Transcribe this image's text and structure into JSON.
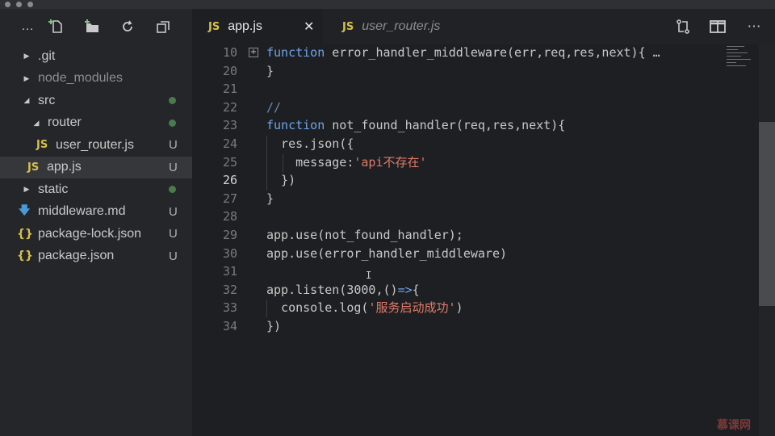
{
  "sidebar": {
    "toolbar": [
      {
        "icon": "more-icon",
        "glyph": "…"
      },
      {
        "icon": "new-file-icon",
        "glyph": "🗋"
      },
      {
        "icon": "new-folder-icon",
        "glyph": "🗀"
      },
      {
        "icon": "refresh-icon",
        "glyph": "↻"
      },
      {
        "icon": "collapse-all-icon",
        "glyph": "⧉"
      }
    ],
    "items": [
      {
        "label": ".git",
        "status": ""
      },
      {
        "label": "node_modules",
        "status": ""
      },
      {
        "label": "src",
        "status": "dot"
      },
      {
        "label": "router",
        "status": "dot"
      },
      {
        "label": "user_router.js",
        "status": "U",
        "icon_text": "JS"
      },
      {
        "label": "app.js",
        "status": "U",
        "icon_text": "JS"
      },
      {
        "label": "static",
        "status": "dot"
      },
      {
        "label": "middleware.md",
        "status": "U"
      },
      {
        "label": "package-lock.json",
        "status": "U",
        "icon_text": "{}"
      },
      {
        "label": "package.json",
        "status": "U",
        "icon_text": "{}"
      }
    ]
  },
  "tabs": [
    {
      "icon_text": "JS",
      "label": "app.js",
      "active": true,
      "close": "✕"
    },
    {
      "icon_text": "JS",
      "label": "user_router.js",
      "active": false
    }
  ],
  "toolbar_actions": [
    {
      "icon": "compare-icon",
      "glyph": "⇄"
    },
    {
      "icon": "split-editor-icon",
      "glyph": "◫"
    },
    {
      "icon": "more-actions-icon",
      "glyph": "⋯"
    }
  ],
  "editor": {
    "lines": [
      {
        "n": "10",
        "tokens": [
          [
            "kw",
            "function"
          ],
          [
            "fn",
            " error_handler_middleware"
          ],
          [
            "punc",
            "(err,req,res,next){"
          ],
          [
            "punc",
            " …"
          ]
        ],
        "fold": "+"
      },
      {
        "n": "20",
        "tokens": [
          [
            "punc",
            "}"
          ]
        ]
      },
      {
        "n": "21",
        "tokens": []
      },
      {
        "n": "22",
        "tokens": [
          [
            "cm",
            "//"
          ]
        ]
      },
      {
        "n": "23",
        "tokens": [
          [
            "kw",
            "function"
          ],
          [
            "fn",
            " not_found_handler"
          ],
          [
            "punc",
            "(req,res,next){"
          ]
        ]
      },
      {
        "n": "24",
        "tokens": [
          [
            "punc",
            "  res.json({"
          ]
        ]
      },
      {
        "n": "25",
        "tokens": [
          [
            "punc",
            "    message:"
          ],
          [
            "str",
            "'api不存在'"
          ]
        ]
      },
      {
        "n": "26",
        "tokens": [
          [
            "punc",
            "  })"
          ]
        ],
        "current": true
      },
      {
        "n": "27",
        "tokens": [
          [
            "punc",
            "}"
          ]
        ]
      },
      {
        "n": "28",
        "tokens": []
      },
      {
        "n": "29",
        "tokens": [
          [
            "punc",
            "app.use(not_found_handler);"
          ]
        ]
      },
      {
        "n": "30",
        "tokens": [
          [
            "punc",
            "app.use(error_handler_middleware)"
          ]
        ]
      },
      {
        "n": "31",
        "tokens": []
      },
      {
        "n": "32",
        "tokens": [
          [
            "punc",
            "app.listen(3000,()"
          ],
          [
            "kw",
            "=>"
          ],
          [
            "punc",
            "{"
          ]
        ]
      },
      {
        "n": "33",
        "tokens": [
          [
            "punc",
            "  console.log("
          ],
          [
            "str",
            "'服务启动成功'"
          ],
          [
            "punc",
            ")"
          ]
        ]
      },
      {
        "n": "34",
        "tokens": [
          [
            "punc",
            "})"
          ]
        ]
      }
    ]
  },
  "watermark": "慕课网",
  "colors": {
    "keyword": "#6da5e8",
    "string": "#e07b6b",
    "js_icon": "#d6c04a",
    "md_icon": "#4a9ad8"
  }
}
